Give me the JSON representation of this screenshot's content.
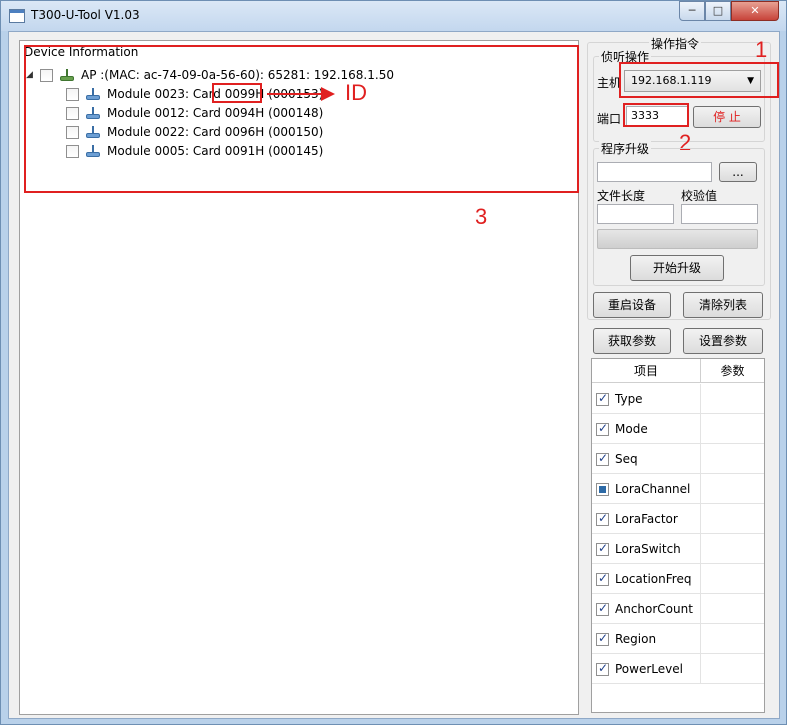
{
  "window": {
    "title": "T300-U-Tool V1.03",
    "controls": {
      "minimize": "─",
      "maximize": "□",
      "close": "✕"
    }
  },
  "device_panel": {
    "caption": "Device Information",
    "root": {
      "label": "AP :(MAC: ac-74-09-0a-56-60): 65281: 192.168.1.50",
      "checked": false
    },
    "modules": [
      {
        "label": "Module 0023: Card 0099H (000153)"
      },
      {
        "label": "Module 0012: Card 0094H (000148)"
      },
      {
        "label": "Module 0022: Card 0096H (000150)"
      },
      {
        "label": "Module 0005: Card 0091H (000145)"
      }
    ]
  },
  "annotations": {
    "one": "1",
    "two": "2",
    "three": "3",
    "id": "ID",
    "color": "#e02020"
  },
  "commands": {
    "title": "操作指令",
    "listen": {
      "title": "侦听操作",
      "host_label": "主机",
      "host_value": "192.168.1.119",
      "port_label": "端口",
      "port_value": "3333",
      "stop_label": "停 止"
    },
    "upgrade": {
      "title": "程序升级",
      "browse_label": "...",
      "file_length_label": "文件长度",
      "checksum_label": "校验值",
      "start_label": "开始升级"
    },
    "restart_label": "重启设备",
    "clear_label": "清除列表",
    "get_params_label": "获取参数",
    "set_params_label": "设置参数"
  },
  "param_table": {
    "headers": [
      "项目",
      "参数"
    ],
    "rows": [
      {
        "name": "Type",
        "state": "checked"
      },
      {
        "name": "Mode",
        "state": "checked"
      },
      {
        "name": "Seq",
        "state": "checked"
      },
      {
        "name": "LoraChannel",
        "state": "indeterminate"
      },
      {
        "name": "LoraFactor",
        "state": "checked"
      },
      {
        "name": "LoraSwitch",
        "state": "checked"
      },
      {
        "name": "LocationFreq",
        "state": "checked"
      },
      {
        "name": "AnchorCount",
        "state": "checked"
      },
      {
        "name": "Region",
        "state": "checked"
      },
      {
        "name": "PowerLevel",
        "state": "checked"
      }
    ]
  }
}
